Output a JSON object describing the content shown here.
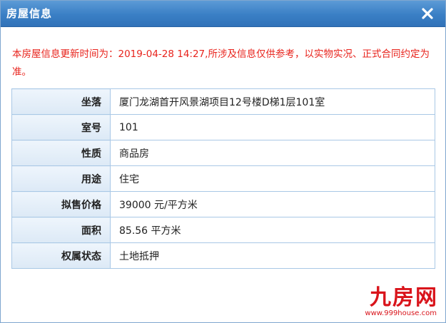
{
  "dialog": {
    "title": "房屋信息",
    "close_label": "×"
  },
  "notice": "本房屋信息更新时间为：2019-04-28 14:27,所涉及信息仅供参考，以实物实况、正式合同约定为准。",
  "rows": [
    {
      "label": "坐落",
      "value": "厦门龙湖首开风景湖项目12号楼D梯1层101室"
    },
    {
      "label": "室号",
      "value": "101"
    },
    {
      "label": "性质",
      "value": "商品房"
    },
    {
      "label": "用途",
      "value": "住宅"
    },
    {
      "label": "拟售价格",
      "value": "39000 元/平方米"
    },
    {
      "label": "面积",
      "value": "85.56 平方米"
    },
    {
      "label": "权属状态",
      "value": "土地抵押"
    }
  ],
  "watermark": {
    "brand": "九房网",
    "url": "www.999house.com"
  },
  "colors": {
    "titlebar": "#3a7fc5",
    "notice_text": "#e8231c",
    "table_border": "#a9c8e6",
    "label_bg": "#e4eef9",
    "watermark": "#d9141b"
  },
  "icons": {
    "close": "close-icon"
  }
}
